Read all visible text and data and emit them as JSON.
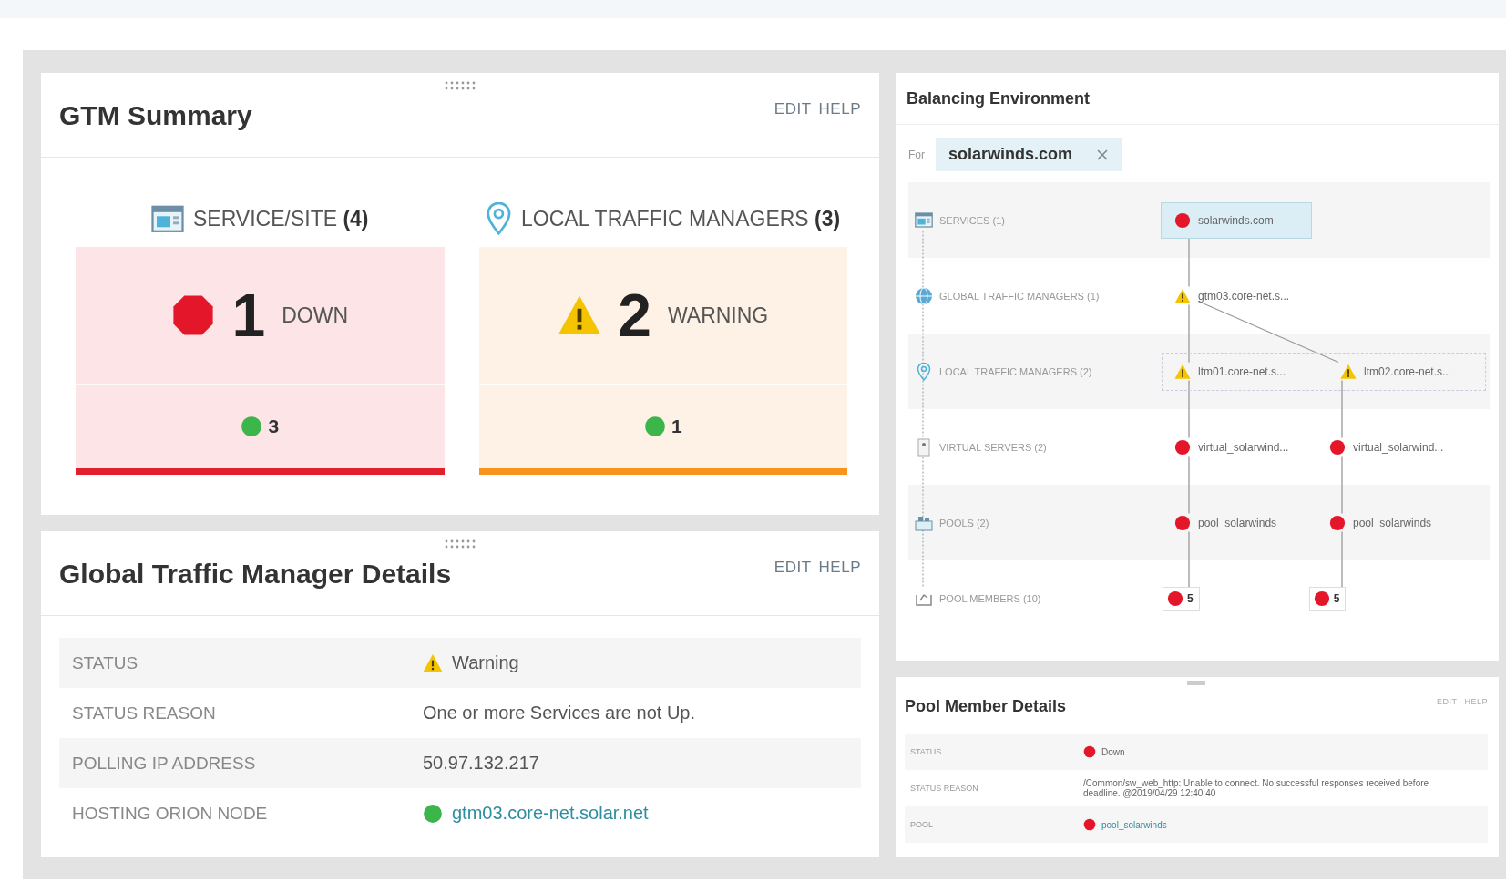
{
  "gtm_summary": {
    "title": "GTM Summary",
    "actions": [
      "EDIT",
      "HELP"
    ],
    "sections": [
      {
        "heading": "SERVICE/SITE",
        "count": "(4)",
        "kind": "down",
        "number": "1",
        "state_label": "DOWN",
        "up_count": "3"
      },
      {
        "heading": "LOCAL TRAFFIC MANAGERS",
        "count": "(3)",
        "kind": "warning",
        "number": "2",
        "state_label": "WARNING",
        "up_count": "1"
      }
    ]
  },
  "gtm_details": {
    "title": "Global Traffic Manager Details",
    "actions": [
      "EDIT",
      "HELP"
    ],
    "rows": [
      {
        "label": "STATUS",
        "value": "Warning",
        "kind": "warning"
      },
      {
        "label": "STATUS REASON",
        "value": "One or more Services are not Up.",
        "kind": "text"
      },
      {
        "label": "POLLING IP ADDRESS",
        "value": "50.97.132.217",
        "kind": "text"
      },
      {
        "label": "HOSTING ORION NODE",
        "value": "gtm03.core-net.solar.net",
        "kind": "link",
        "color": "#3cb54a"
      }
    ]
  },
  "balancing": {
    "title": "Balancing Environment",
    "filter": {
      "label": "For",
      "value": "solarwinds.com"
    },
    "layers": [
      {
        "label": "SERVICES (1)",
        "kind": "services",
        "grouped": false,
        "nodes": [
          {
            "text": "solarwinds.com",
            "kind": "down",
            "selected": true
          }
        ]
      },
      {
        "label": "GLOBAL TRAFFIC MANAGERS (1)",
        "kind": "gtm",
        "grouped": false,
        "nodes": [
          {
            "text": "gtm03.core-net.s...",
            "kind": "warning",
            "selected": false
          }
        ]
      },
      {
        "label": "LOCAL TRAFFIC MANAGERS (2)",
        "kind": "ltm",
        "grouped": true,
        "nodes": [
          {
            "text": "ltm01.core-net.s...",
            "kind": "warning",
            "selected": false
          },
          {
            "text": "ltm02.core-net.s...",
            "kind": "warning",
            "selected": false
          }
        ]
      },
      {
        "label": "VIRTUAL SERVERS (2)",
        "kind": "virtual",
        "grouped": false,
        "nodes": [
          {
            "text": "virtual_solarwind...",
            "kind": "down",
            "selected": false
          },
          {
            "text": "virtual_solarwind...",
            "kind": "down",
            "selected": false
          }
        ]
      },
      {
        "label": "POOLS (2)",
        "kind": "pools",
        "grouped": false,
        "nodes": [
          {
            "text": "pool_solarwinds",
            "kind": "down",
            "selected": false
          },
          {
            "text": "pool_solarwinds",
            "kind": "down",
            "selected": false
          }
        ]
      },
      {
        "label": "POOL MEMBERS (10)",
        "kind": "members",
        "grouped": false,
        "nodes": [
          {
            "text": "5",
            "kind": "down",
            "selected": false
          },
          {
            "text": "5",
            "kind": "down",
            "selected": false
          }
        ]
      }
    ]
  },
  "pool_member": {
    "title": "Pool Member Details",
    "actions": [
      "EDIT",
      "HELP"
    ],
    "rows": [
      {
        "label": "STATUS",
        "value": "Down",
        "kind": "down"
      },
      {
        "label": "STATUS REASON",
        "value": "/Common/sw_web_http: Unable to connect. No successful responses received before deadline. @2019/04/29 12:40:40",
        "kind": "text"
      },
      {
        "label": "POOL",
        "value": "pool_solarwinds",
        "kind": "link",
        "color": "#e3162a"
      }
    ]
  }
}
